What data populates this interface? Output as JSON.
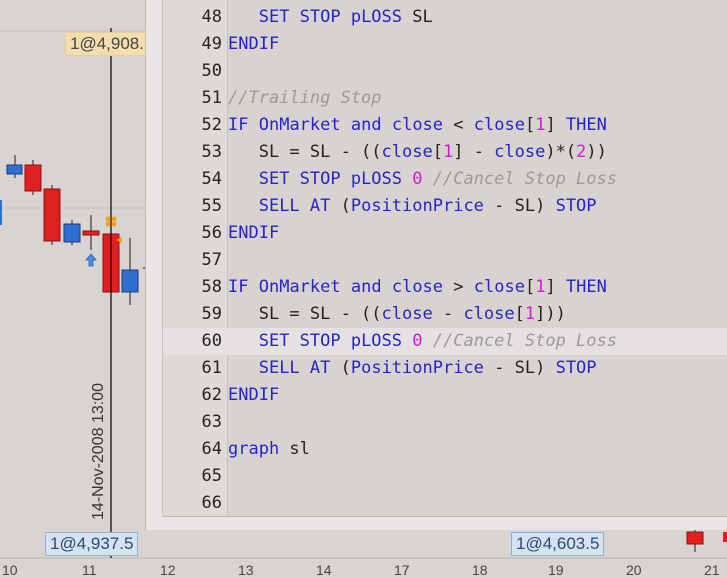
{
  "chart": {
    "price_tag_top": "1@4,908.",
    "price_tag_bottom_left": "1@4,937.5",
    "price_tag_bottom_mid": "1@4,603.5",
    "cursor_date": "14-Nov-2008 13:00",
    "x_ticks": [
      "10",
      "11",
      "12",
      "13",
      "14",
      "17",
      "18",
      "19",
      "20",
      "21"
    ]
  },
  "editor": {
    "lines": [
      {
        "num": "48",
        "parts": [
          {
            "t": "   "
          },
          {
            "t": "SET STOP pLOSS",
            "c": "kw"
          },
          {
            "t": " SL"
          }
        ]
      },
      {
        "num": "49",
        "parts": [
          {
            "t": "ENDIF",
            "c": "kw"
          }
        ]
      },
      {
        "num": "50",
        "parts": []
      },
      {
        "num": "51",
        "parts": [
          {
            "t": "//Trailing Stop",
            "c": "cm"
          }
        ]
      },
      {
        "num": "52",
        "parts": [
          {
            "t": "IF",
            "c": "kw"
          },
          {
            "t": " "
          },
          {
            "t": "OnMarket",
            "c": "kw"
          },
          {
            "t": " "
          },
          {
            "t": "and",
            "c": "kw"
          },
          {
            "t": " "
          },
          {
            "t": "close",
            "c": "kw"
          },
          {
            "t": " < "
          },
          {
            "t": "close",
            "c": "kw"
          },
          {
            "t": "["
          },
          {
            "t": "1",
            "c": "num"
          },
          {
            "t": "] "
          },
          {
            "t": "THEN",
            "c": "kw"
          }
        ]
      },
      {
        "num": "53",
        "parts": [
          {
            "t": "   SL = SL - (("
          },
          {
            "t": "close",
            "c": "kw"
          },
          {
            "t": "["
          },
          {
            "t": "1",
            "c": "num"
          },
          {
            "t": "] - "
          },
          {
            "t": "close",
            "c": "kw"
          },
          {
            "t": ")*("
          },
          {
            "t": "2",
            "c": "num"
          },
          {
            "t": "))"
          }
        ]
      },
      {
        "num": "54",
        "parts": [
          {
            "t": "   "
          },
          {
            "t": "SET STOP pLOSS",
            "c": "kw"
          },
          {
            "t": " "
          },
          {
            "t": "0",
            "c": "num"
          },
          {
            "t": " "
          },
          {
            "t": "//Cancel Stop Loss",
            "c": "cm"
          }
        ]
      },
      {
        "num": "55",
        "parts": [
          {
            "t": "   "
          },
          {
            "t": "SELL AT",
            "c": "kw"
          },
          {
            "t": " ("
          },
          {
            "t": "PositionPrice",
            "c": "kw"
          },
          {
            "t": " - SL) "
          },
          {
            "t": "STOP",
            "c": "kw"
          }
        ]
      },
      {
        "num": "56",
        "parts": [
          {
            "t": "ENDIF",
            "c": "kw"
          }
        ]
      },
      {
        "num": "57",
        "parts": []
      },
      {
        "num": "58",
        "parts": [
          {
            "t": "IF",
            "c": "kw"
          },
          {
            "t": " "
          },
          {
            "t": "OnMarket",
            "c": "kw"
          },
          {
            "t": " "
          },
          {
            "t": "and",
            "c": "kw"
          },
          {
            "t": " "
          },
          {
            "t": "close",
            "c": "kw"
          },
          {
            "t": " > "
          },
          {
            "t": "close",
            "c": "kw"
          },
          {
            "t": "["
          },
          {
            "t": "1",
            "c": "num"
          },
          {
            "t": "] "
          },
          {
            "t": "THEN",
            "c": "kw"
          }
        ]
      },
      {
        "num": "59",
        "parts": [
          {
            "t": "   SL = SL - (("
          },
          {
            "t": "close",
            "c": "kw"
          },
          {
            "t": " - "
          },
          {
            "t": "close",
            "c": "kw"
          },
          {
            "t": "["
          },
          {
            "t": "1",
            "c": "num"
          },
          {
            "t": "]))"
          }
        ]
      },
      {
        "num": "60",
        "hl": true,
        "parts": [
          {
            "t": "   "
          },
          {
            "t": "SET STOP pLOSS",
            "c": "kw"
          },
          {
            "t": " "
          },
          {
            "t": "0",
            "c": "num"
          },
          {
            "t": " "
          },
          {
            "t": "//Cancel Stop Loss",
            "c": "cm"
          }
        ]
      },
      {
        "num": "61",
        "parts": [
          {
            "t": "   "
          },
          {
            "t": "SELL AT",
            "c": "kw"
          },
          {
            "t": " ("
          },
          {
            "t": "PositionPrice",
            "c": "kw"
          },
          {
            "t": " - SL) "
          },
          {
            "t": "STOP",
            "c": "kw"
          }
        ]
      },
      {
        "num": "62",
        "parts": [
          {
            "t": "ENDIF",
            "c": "kw"
          }
        ]
      },
      {
        "num": "63",
        "parts": []
      },
      {
        "num": "64",
        "parts": [
          {
            "t": "graph",
            "c": "kw"
          },
          {
            "t": " sl"
          }
        ]
      },
      {
        "num": "65",
        "parts": []
      },
      {
        "num": "66",
        "parts": []
      }
    ]
  },
  "colors": {
    "keyword": "#2424c8",
    "number": "#d21ad2",
    "comment": "#9a9a9a",
    "candle_up": "#2f6fd0",
    "candle_down": "#e02020"
  }
}
